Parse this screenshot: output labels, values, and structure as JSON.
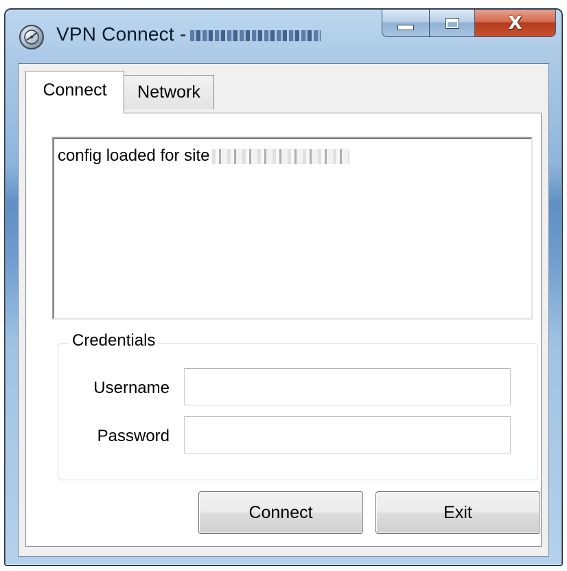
{
  "window": {
    "title": "VPN Connect -",
    "title_suffix_redacted": true,
    "caption_buttons": {
      "minimize_icon": "minimize-icon",
      "maximize_icon": "maximize-icon",
      "close_icon": "close-icon",
      "close_glyph": "X"
    },
    "app_icon": "vpn-globe-icon"
  },
  "tabs": [
    {
      "label": "Connect",
      "active": true
    },
    {
      "label": "Network",
      "active": false
    }
  ],
  "log": {
    "lines": [
      {
        "text": "config loaded for site",
        "redacted_suffix": true
      }
    ]
  },
  "credentials": {
    "legend": "Credentials",
    "username": {
      "label": "Username",
      "value": "",
      "placeholder": ""
    },
    "password": {
      "label": "Password",
      "value": "",
      "placeholder": ""
    }
  },
  "buttons": {
    "connect_label": "Connect",
    "exit_label": "Exit"
  },
  "colors": {
    "close_button": "#c8532f",
    "titlebar": "#8eb4dc",
    "client_bg": "#f0f0f0"
  }
}
